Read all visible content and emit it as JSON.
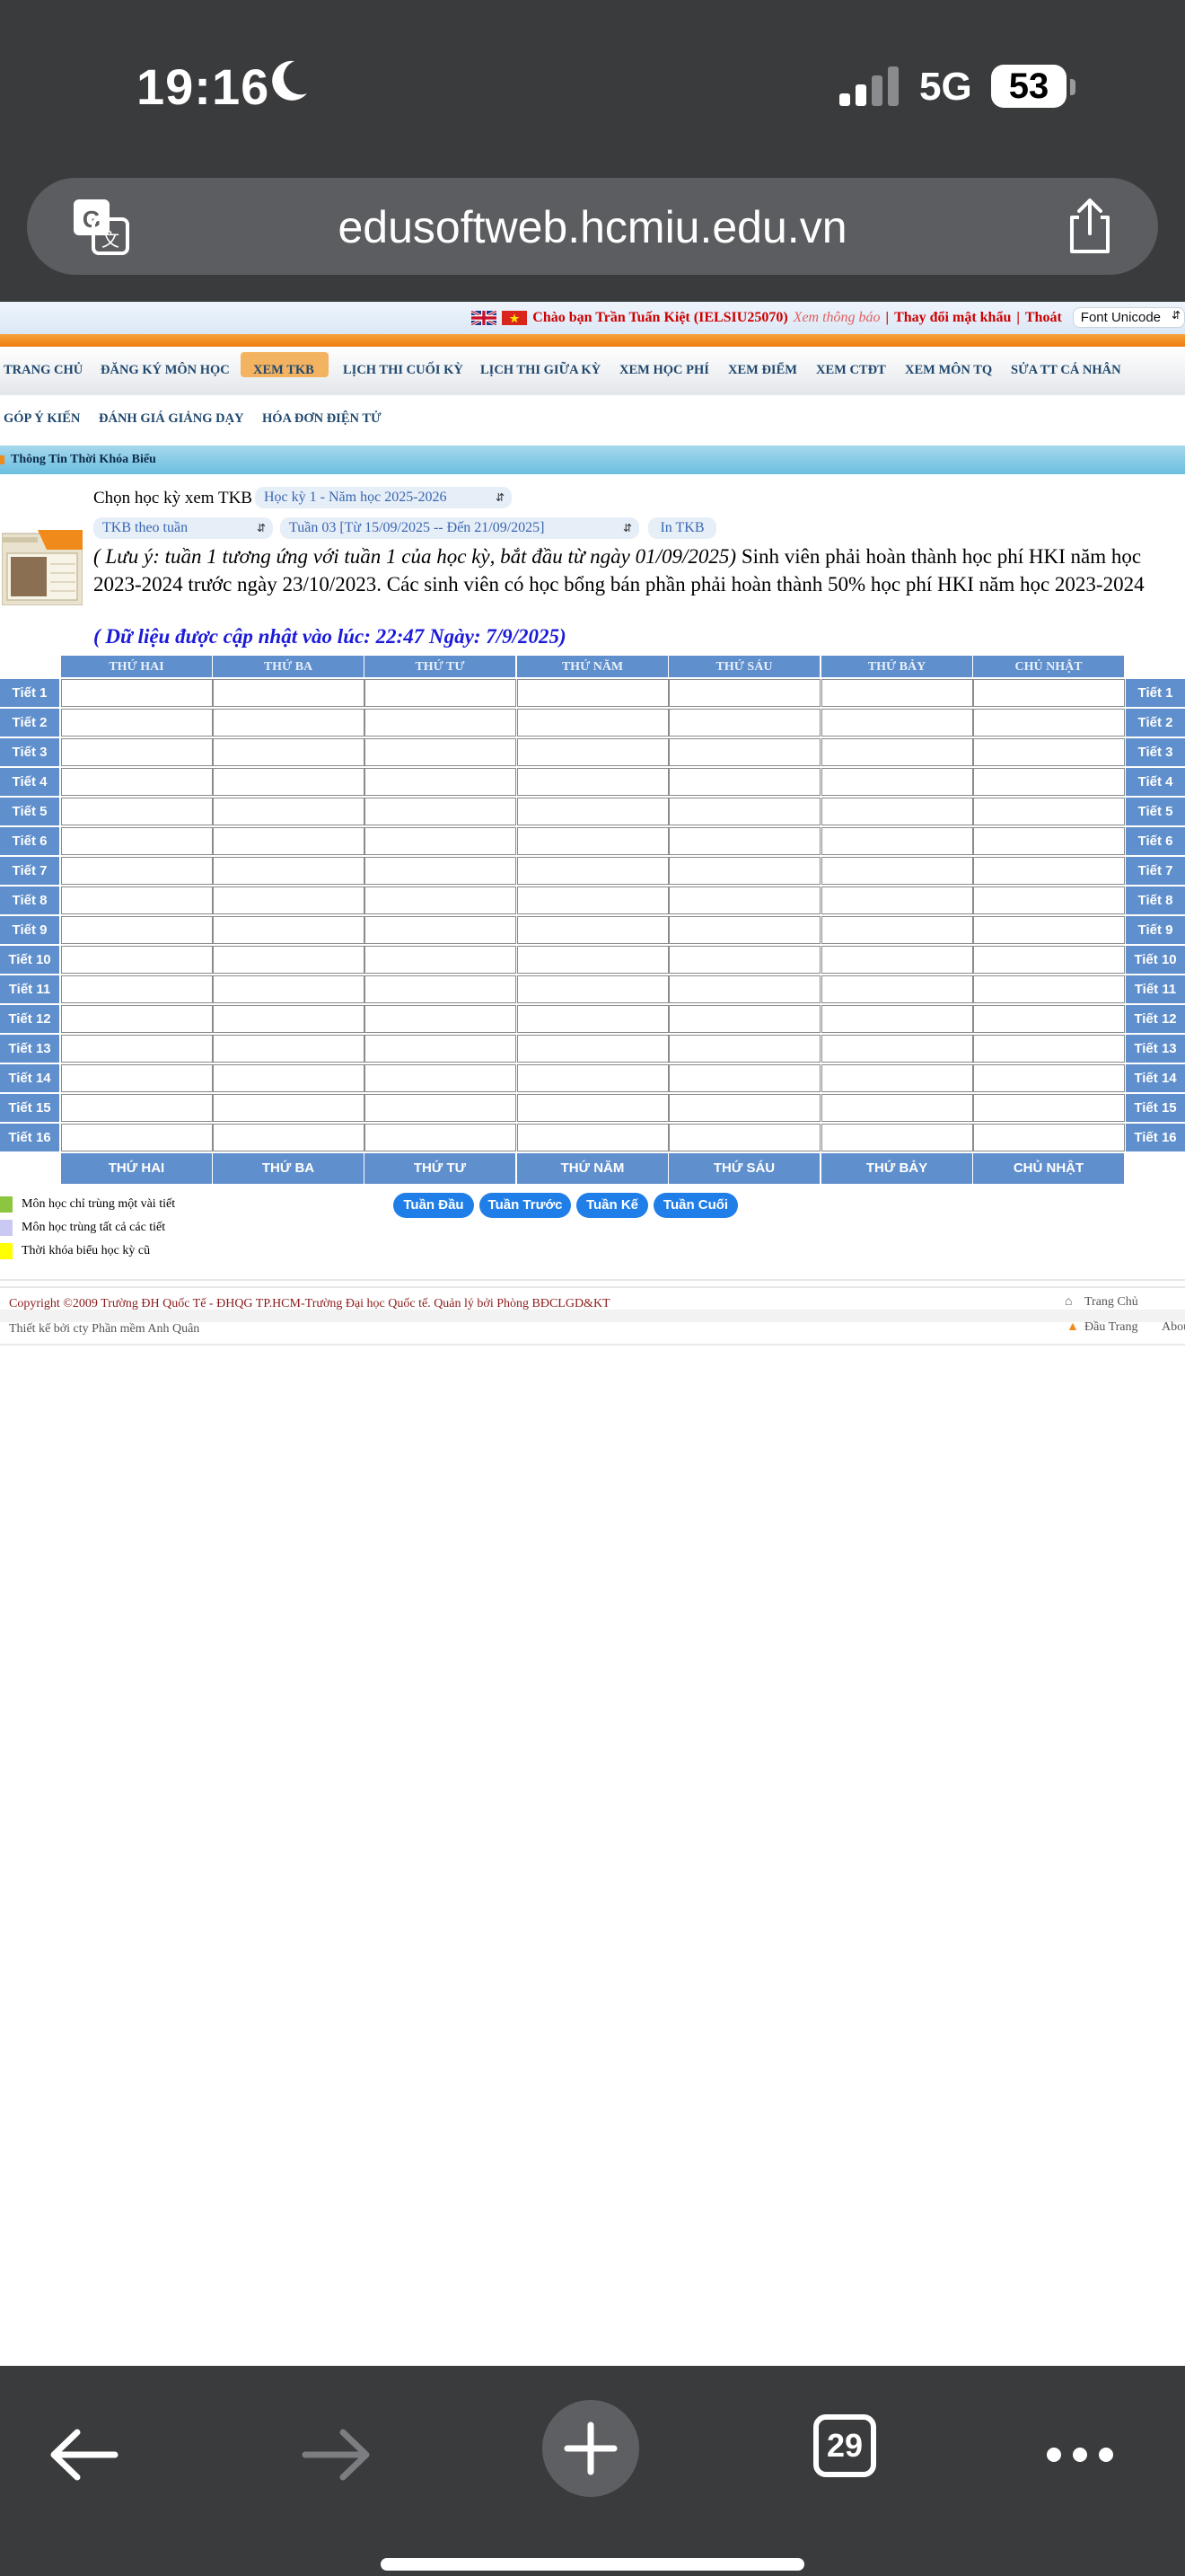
{
  "status": {
    "time": "19:16",
    "network": "5G",
    "battery": "53"
  },
  "browser": {
    "url": "edusoftweb.hcmiu.edu.vn",
    "tab_count": "29"
  },
  "header": {
    "greeting": "Chào bạn Trần Tuấn Kiệt (IELSIU25070)",
    "notice_link": "Xem thông báo",
    "sep": "|",
    "change_password": "Thay đổi mật khẩu",
    "logout": "Thoát",
    "font_select": "Font Unicode"
  },
  "nav": {
    "row1": [
      "TRANG CHỦ",
      "ĐĂNG KÝ MÔN HỌC",
      "XEM TKB",
      "LỊCH THI CUỐI KỲ",
      "LỊCH THI GIỮA KỲ",
      "XEM HỌC PHÍ",
      "XEM ĐIỂM",
      "XEM CTĐT",
      "XEM MÔN TQ",
      "SỬA TT CÁ NHÂN"
    ],
    "row2": [
      "GÓP Ý KIẾN",
      "ĐÁNH GIÁ GIẢNG DẠY",
      "HÓA ĐƠN ĐIỆN TỬ"
    ],
    "active": "XEM TKB"
  },
  "section_title": "Thông Tin Thời Khóa Biểu",
  "form": {
    "semester_label": "Chọn học kỳ xem TKB",
    "semester_value": "Học kỳ 1 - Năm học 2025-2026",
    "view_mode": "TKB theo tuần",
    "week_value": "Tuần 03 [Từ 15/09/2025 -- Đến 21/09/2025]",
    "print_button": "In TKB"
  },
  "notice": {
    "italic": "( Lưu ý: tuần 1 tương ứng với tuần 1 của học kỳ, bắt đầu từ ngày 01/09/2025)",
    "text": " Sinh viên phải hoàn thành học phí HKI năm học 2023-2024 trước ngày 23/10/2023. Các sinh viên có học bổng bán phần phải hoàn thành 50% học phí HKI năm học 2023-2024",
    "updated": "( Dữ liệu được cập nhật vào lúc: 22:47 Ngày: 7/9/2025)"
  },
  "timetable": {
    "days_header": [
      "THỨ HAI",
      "THỨ BA",
      "THỨ TƯ",
      "THỨ NĂM",
      "THỨ SÁU",
      "THỨ BẢY",
      "CHỦ NHẬT"
    ],
    "days_footer": [
      "THỨ HAI",
      "THỨ BA",
      "THỨ TƯ",
      "THỨ NĂM",
      "THỨ SÁU",
      "THỨ BẢY",
      "CHỦ NHẬT"
    ],
    "periods": [
      "Tiết 1",
      "Tiết 2",
      "Tiết 3",
      "Tiết 4",
      "Tiết 5",
      "Tiết 6",
      "Tiết 7",
      "Tiết 8",
      "Tiết 9",
      "Tiết 10",
      "Tiết 11",
      "Tiết 12",
      "Tiết 13",
      "Tiết 14",
      "Tiết 15",
      "Tiết 16"
    ]
  },
  "legend": [
    {
      "label": "Môn học chỉ trùng một vài tiết",
      "color": "#8cc63f"
    },
    {
      "label": "Môn học trùng tất cả các tiết",
      "color": "#c9c9f2"
    },
    {
      "label": "Thời khóa biểu học kỳ cũ",
      "color": "#ffff00"
    }
  ],
  "week_nav": [
    "Tuần Đầu",
    "Tuần Trước",
    "Tuần Kế",
    "Tuần Cuối"
  ],
  "footer": {
    "copyright": "Copyright ©2009 Trường ĐH Quốc Tế - ĐHQG TP.HCM-Trường Đại học Quốc tế. Quản lý bởi Phòng BĐCLGD&KT",
    "credit": "Thiết kế bởi cty Phần mềm Anh Quân",
    "home_link": "Trang Chủ",
    "top_link": "Đầu Trang",
    "about_link": "Abou"
  }
}
